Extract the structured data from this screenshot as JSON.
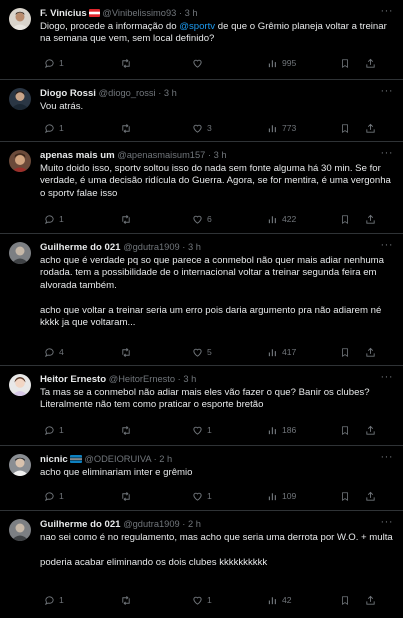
{
  "colors": {
    "background": "#000000",
    "text": "#e7e9ea",
    "muted": "#71767b",
    "link": "#1d9bf0",
    "divider": "#2f3336"
  },
  "icons": {
    "more": "more-dots-icon",
    "reply": "reply-icon",
    "retweet": "retweet-icon",
    "like": "heart-icon",
    "views": "views-icon",
    "bookmark": "bookmark-icon",
    "share": "share-icon"
  },
  "replies": [
    {
      "name": "F. Vinícius",
      "handle": "@Vinibelissimo93",
      "time": "3 h",
      "text_before": "Diogo, procede a informação do ",
      "mention": "@sportv",
      "text_after": " de que o Grêmio planeja voltar a treinar na semana que vem, sem local definido?",
      "replies": "1",
      "retweets": "",
      "likes": "",
      "views": "995"
    },
    {
      "name": "Diogo Rossi",
      "handle": "@diogo_rossi",
      "time": "3 h",
      "text": "Vou atrás.",
      "replies": "1",
      "retweets": "",
      "likes": "3",
      "views": "773"
    },
    {
      "name": "apenas mais um",
      "handle": "@apenasmaisum157",
      "time": "3 h",
      "text": "Muito doido isso, sportv soltou isso do nada sem fonte alguma há 30 min. Se for verdade, é uma decisão ridícula do Guerra. Agora, se for mentira, é uma vergonha o sportv falae isso",
      "replies": "1",
      "retweets": "",
      "likes": "6",
      "views": "422"
    },
    {
      "name": "Guilherme do 021",
      "handle": "@gdutra1909",
      "time": "3 h",
      "text": "acho que é verdade pq so que parece a conmebol não quer mais adiar nenhuma rodada. tem a possibilidade de o internacional voltar a treinar segunda feira em alvorada também.\n\nacho que voltar a treinar seria um erro pois daria argumento pra não adiarem né kkkk ja que voltaram...",
      "replies": "4",
      "retweets": "",
      "likes": "5",
      "views": "417"
    },
    {
      "name": "Heitor Ernesto",
      "handle": "@HeitorErnesto",
      "time": "3 h",
      "text": "Ta mas se a conmebol não adiar mais eles vão fazer o que? Banir os clubes? Literalmente não tem como praticar o esporte bretão",
      "replies": "1",
      "retweets": "",
      "likes": "1",
      "views": "186"
    },
    {
      "name": "nicnic",
      "handle": "@ODEIORUIVA",
      "time": "2 h",
      "text": "acho que eliminariam inter e grêmio",
      "replies": "1",
      "retweets": "",
      "likes": "1",
      "views": "109"
    },
    {
      "name": "Guilherme do 021",
      "handle": "@gdutra1909",
      "time": "2 h",
      "text": "nao sei como é no regulamento, mas acho que seria uma derrota por W.O. + multa\n\npoderia acabar eliminando os dois clubes kkkkkkkkkk",
      "replies": "1",
      "retweets": "",
      "likes": "1",
      "views": "42"
    }
  ]
}
